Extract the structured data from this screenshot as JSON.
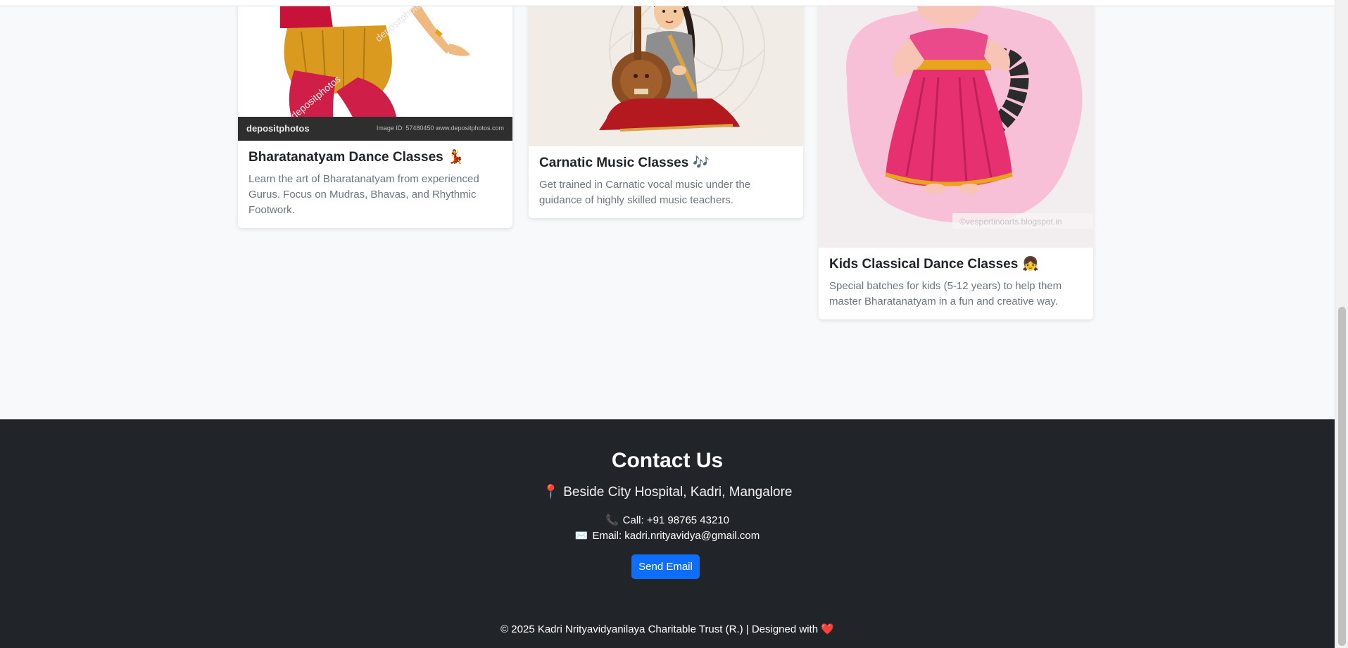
{
  "classes": [
    {
      "title": "Bharatanatyam Dance Classes",
      "emoji": "💃",
      "description": "Learn the art of Bharatanatyam from experienced Gurus. Focus on Mudras, Bhavas, and Rhythmic Footwork.",
      "watermark_logo": "depositphotos",
      "watermark_right": "Image ID: 57480450   www.depositphotos.com"
    },
    {
      "title": "Carnatic Music Classes",
      "emoji": "🎶",
      "description": "Get trained in Carnatic vocal music under the guidance of highly skilled music teachers."
    },
    {
      "title": "Kids Classical Dance Classes",
      "emoji": "👧",
      "description": "Special batches for kids (5-12 years) to help them master Bharatanatyam in a fun and creative way.",
      "watermark": "©vespertinoarts.blogspot.in"
    }
  ],
  "footer": {
    "heading": "Contact Us",
    "address_icon": "📍",
    "address": "Beside City Hospital, Kadri, Mangalore",
    "call_icon": "📞",
    "call": "Call: +91 98765 43210",
    "email_icon": "✉️",
    "email": "Email: kadri.nrityavidya@gmail.com",
    "send_button": "Send Email",
    "copyright": "© 2025 Kadri Nrityavidyanilaya Charitable Trust (R.) | Designed with",
    "heart_icon": "❤️"
  },
  "colors": {
    "footer_bg": "#212529",
    "button_bg": "#0d6efd",
    "page_bg": "#f8f9fa"
  }
}
